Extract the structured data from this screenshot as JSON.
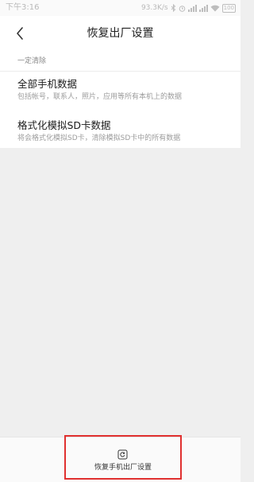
{
  "status_bar": {
    "time": "下午3:16",
    "net_speed": "93.3K/s",
    "battery": "100"
  },
  "header": {
    "title": "恢复出厂设置"
  },
  "section": {
    "label": "一定清除"
  },
  "items": [
    {
      "title": "全部手机数据",
      "subtitle": "包括帐号，联系人，照片，应用等所有本机上的数据"
    },
    {
      "title": "格式化模拟SD卡数据",
      "subtitle": "将会格式化模拟SD卡，清除模拟SD卡中的所有数据"
    }
  ],
  "bottom": {
    "reset_label": "恢复手机出厂设置"
  },
  "colors": {
    "highlight": "#e0302f",
    "background": "#efefef"
  }
}
